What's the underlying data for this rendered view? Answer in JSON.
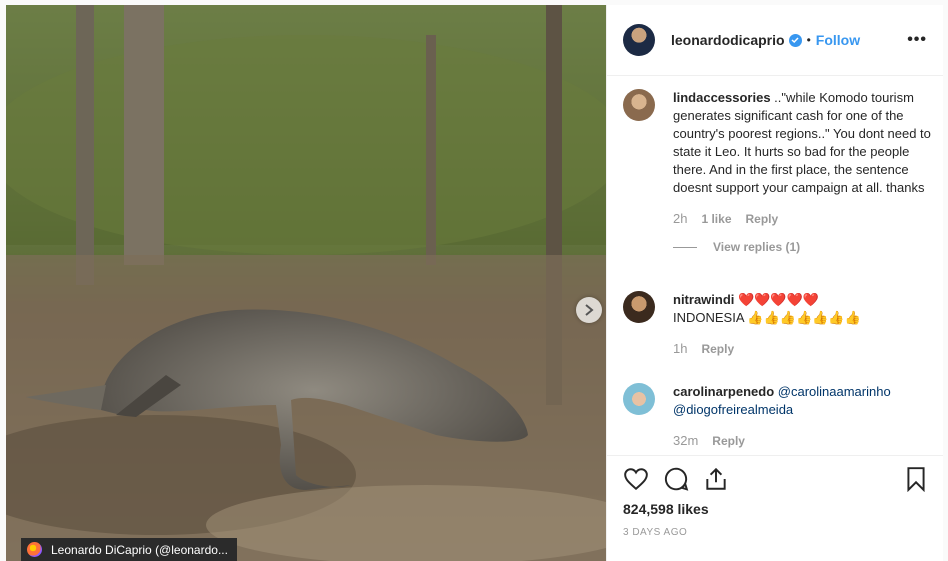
{
  "post": {
    "username": "leonardodicaprio",
    "separator": "•",
    "follow_label": "Follow",
    "more_label": "•••",
    "likes": "824,598 likes",
    "date": "3 DAYS AGO"
  },
  "comments": [
    {
      "user": "lindaccessories",
      "text": " ..\"while Komodo tourism generates significant cash for one of the country's poorest regions..\" You dont need to state it Leo. It hurts so bad for the people there. And in the first place, the sentence doesnt support your campaign at all. thanks",
      "time": "2h",
      "likes": "1 like",
      "reply": "Reply",
      "view_replies": "View replies (1)"
    },
    {
      "user": "nitrawindi",
      "text_line1": " ❤️❤️❤️❤️❤️",
      "text_line2": "INDONESIA 👍👍👍👍👍👍👍",
      "time": "1h",
      "reply": "Reply"
    },
    {
      "user": "carolinarpenedo",
      "mention1": "@carolinaamarinho",
      "mention2": "@diogofreirealmeida",
      "time": "32m",
      "reply": "Reply"
    }
  ],
  "taskbar": {
    "tooltip": "Leonardo DiCaprio (@leonardo..."
  },
  "colors": {
    "accent": "#3897f0",
    "text": "#262626",
    "muted": "#999999"
  },
  "icons": [
    "heart-icon",
    "comment-icon",
    "share-icon",
    "bookmark-icon",
    "verified-icon",
    "chevron-right-icon",
    "firefox-icon"
  ]
}
